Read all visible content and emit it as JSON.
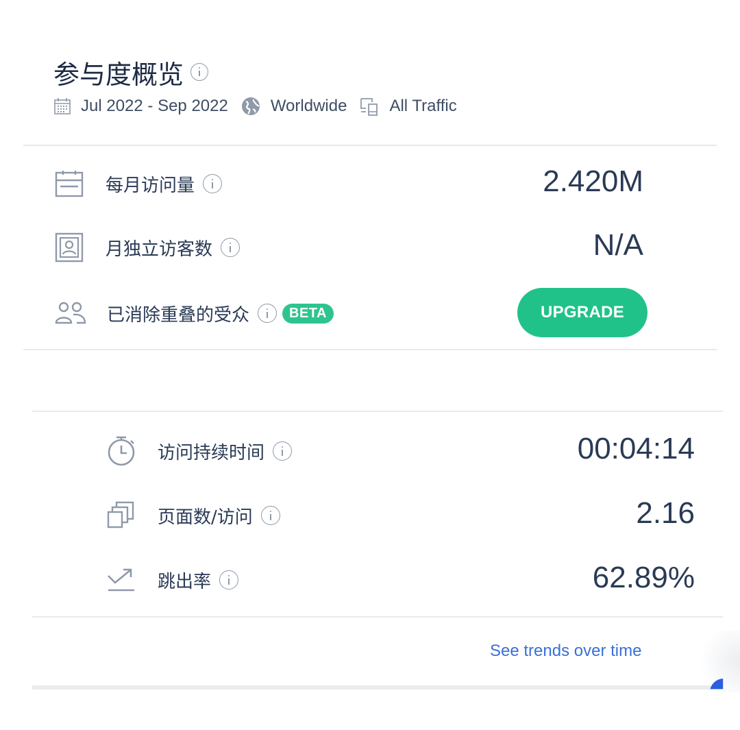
{
  "header": {
    "title": "参与度概览",
    "date_range": "Jul 2022 - Sep 2022",
    "region": "Worldwide",
    "traffic": "All Traffic"
  },
  "section1": {
    "rows": [
      {
        "label": "每月访问量",
        "value": "2.420M",
        "icon": "calendar-icon"
      },
      {
        "label": "月独立访客数",
        "value": "N/A",
        "icon": "visitor-badge-icon"
      },
      {
        "label": "已消除重叠的受众",
        "badge": "BETA",
        "button": "UPGRADE",
        "icon": "people-icon"
      }
    ]
  },
  "section2": {
    "rows": [
      {
        "label": "访问持续时间",
        "value": "00:04:14",
        "icon": "stopwatch-icon"
      },
      {
        "label": "页面数/访问",
        "value": "2.16",
        "icon": "pages-icon"
      },
      {
        "label": "跳出率",
        "value": "62.89%",
        "icon": "bounce-icon"
      }
    ],
    "link": "See trends over time"
  },
  "colors": {
    "accent_green": "#21c28a",
    "link_blue": "#3a6fd8",
    "text_dark": "#2a3a55",
    "icon_gray": "#8f99a8"
  }
}
